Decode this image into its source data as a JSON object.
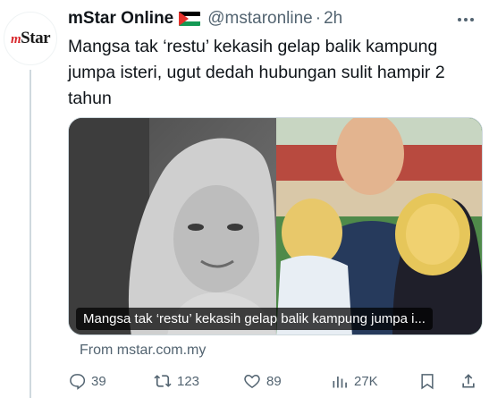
{
  "author": {
    "avatar_text": "Star",
    "avatar_prefix": "m",
    "name": "mStar Online",
    "flag": "palestine-flag",
    "handle": "@mstaronline",
    "separator": "·",
    "time": "2h"
  },
  "tweet": {
    "text": "Mangsa tak ‘restu’ kekasih gelap balik kampung jumpa isteri, ugut dedah hubungan sulit hampir 2 tahun"
  },
  "card": {
    "caption": "Mangsa tak ‘restu’ kekasih gelap balik kampung jumpa i...",
    "source": "From mstar.com.my"
  },
  "actions": {
    "replies": "39",
    "retweets": "123",
    "likes": "89",
    "views": "27K"
  },
  "colors": {
    "text": "#0f1419",
    "muted": "#536471",
    "border": "#cfd9de"
  }
}
